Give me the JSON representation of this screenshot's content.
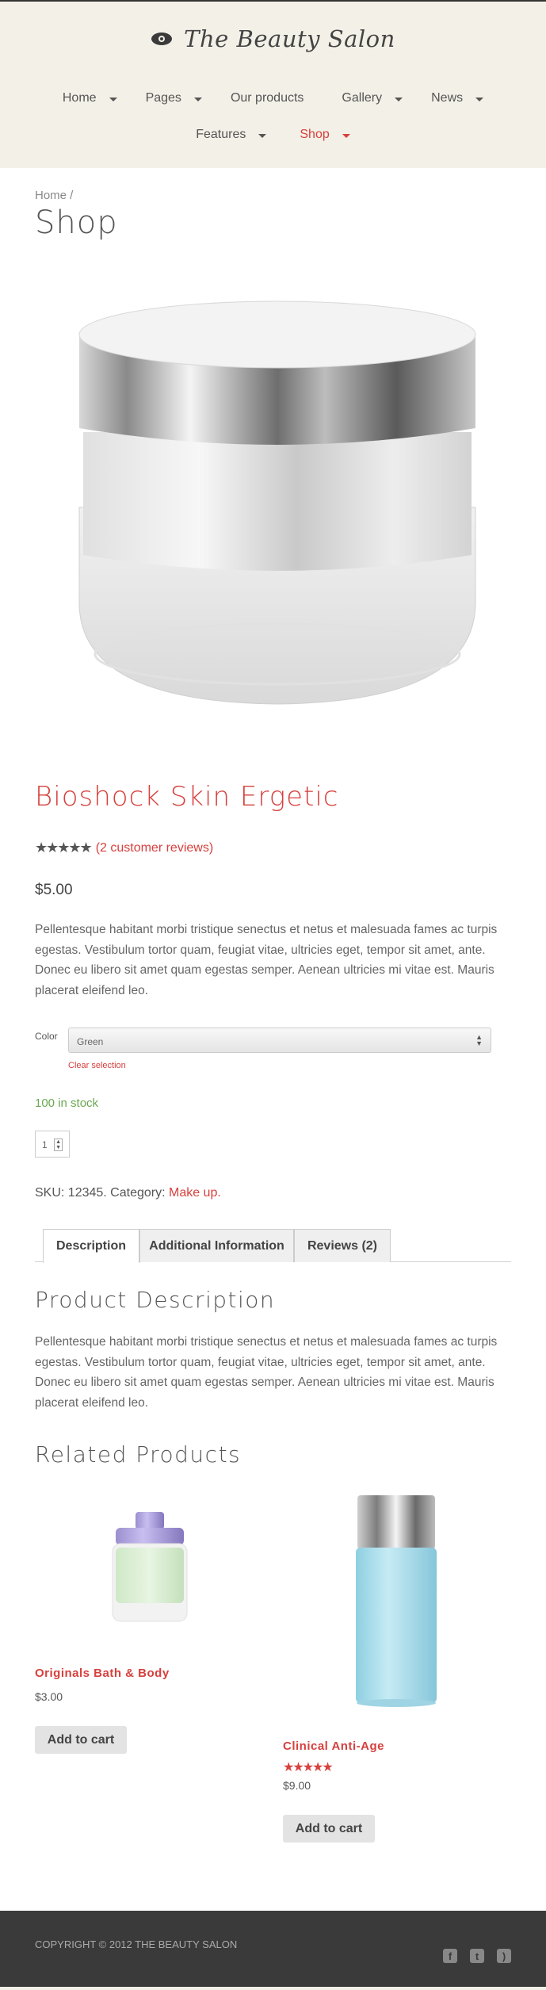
{
  "header": {
    "logo_text": "The Beauty Salon",
    "nav": [
      {
        "label": "Home",
        "has_dropdown": true
      },
      {
        "label": "Pages",
        "has_dropdown": true
      },
      {
        "label": "Our products",
        "has_dropdown": false
      },
      {
        "label": "Gallery",
        "has_dropdown": true
      },
      {
        "label": "News",
        "has_dropdown": true
      },
      {
        "label": "Features",
        "has_dropdown": true
      },
      {
        "label": "Shop",
        "has_dropdown": true,
        "active": true
      }
    ]
  },
  "breadcrumb": "Home /",
  "page_title": "Shop",
  "product": {
    "name": "Bioshock Skin Ergetic",
    "rating_stars": 4.5,
    "reviews_link": "(2 customer reviews)",
    "price": "$5.00",
    "short_description": "Pellentesque habitant morbi tristique senectus et netus et malesuada fames ac turpis egestas. Vestibulum tortor quam, feugiat vitae, ultricies eget, tempor sit amet, ante. Donec eu libero sit amet quam egestas semper. Aenean ultricies mi vitae est. Mauris placerat eleifend leo.",
    "color_label": "Color",
    "color_selected": "Green",
    "clear_selection": "Clear selection",
    "stock": "100 in stock",
    "quantity": "1",
    "sku_text": "SKU: 12345. Category: ",
    "category": "Make up."
  },
  "tabs": [
    {
      "label": "Description",
      "active": true
    },
    {
      "label": "Additional Information",
      "active": false
    },
    {
      "label": "Reviews (2)",
      "active": false
    }
  ],
  "description_section": {
    "title": "Product Description",
    "text": "Pellentesque habitant morbi tristique senectus et netus et malesuada fames ac turpis egestas. Vestibulum tortor quam, feugiat vitae, ultricies eget, tempor sit amet, ante. Donec eu libero sit amet quam egestas semper. Aenean ultricies mi vitae est. Mauris placerat eleifend leo."
  },
  "related": {
    "title": "Related Products",
    "products": [
      {
        "name": "Originals Bath & Body",
        "price": "$3.00",
        "button": "Add to cart"
      },
      {
        "name": "Clinical Anti-Age",
        "price": "$9.00",
        "stars": "★★★★★",
        "button": "Add to cart"
      }
    ]
  },
  "footer": {
    "copyright": "COPYRIGHT © 2012 THE BEAUTY SALON",
    "social_icons": [
      "facebook-icon",
      "twitter-icon",
      "rss-icon"
    ]
  },
  "colors": {
    "accent": "#d6403d",
    "header_bg": "#f3f0e7",
    "footer_bg": "#3a3a3a",
    "stock_green": "#6aa84f"
  }
}
